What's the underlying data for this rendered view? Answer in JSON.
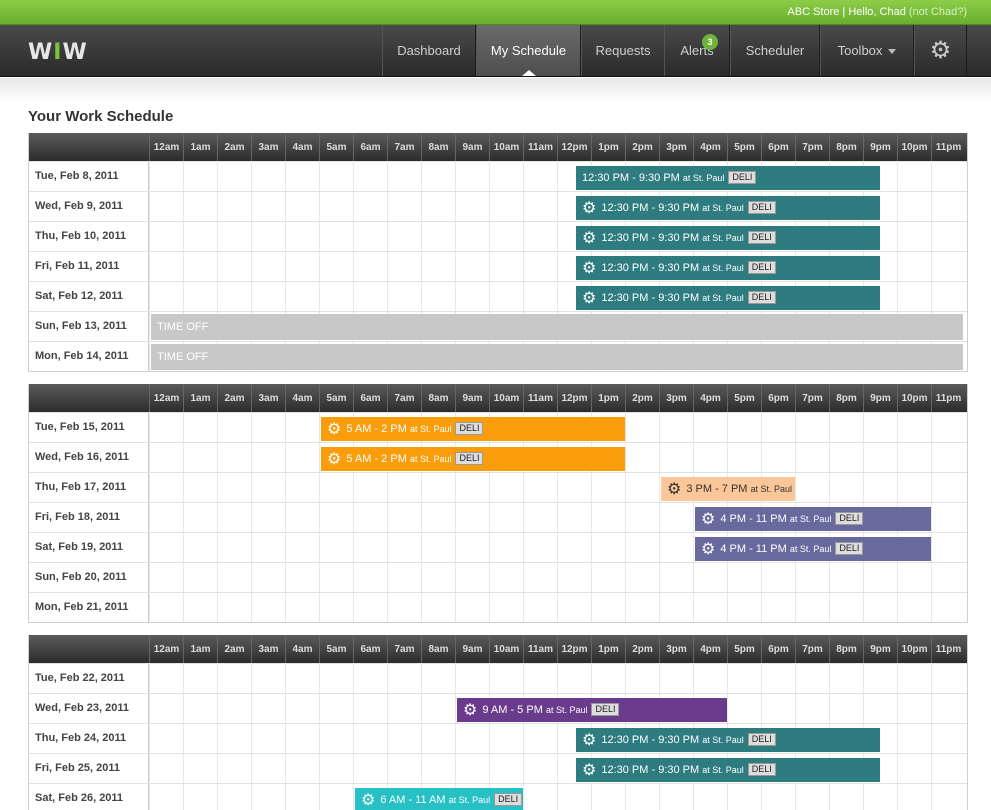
{
  "topbar": {
    "store": "ABC Store",
    "greeting": "Hello, Chad",
    "not_user": "(not Chad?)"
  },
  "logo": {
    "part1": "W",
    "part2": "I",
    "part3": "W"
  },
  "nav": [
    {
      "key": "dashboard",
      "label": "Dashboard",
      "active": false
    },
    {
      "key": "my-schedule",
      "label": "My Schedule",
      "active": true
    },
    {
      "key": "requests",
      "label": "Requests",
      "active": false
    },
    {
      "key": "alerts",
      "label": "Alerts",
      "active": false,
      "badge": "3"
    },
    {
      "key": "scheduler",
      "label": "Scheduler",
      "active": false
    },
    {
      "key": "toolbox",
      "label": "Toolbox",
      "active": false,
      "dropdown": true
    }
  ],
  "settings_icon": "gear-icon",
  "page_title": "Your Work Schedule",
  "hours": [
    "12am",
    "1am",
    "2am",
    "3am",
    "4am",
    "5am",
    "6am",
    "7am",
    "8am",
    "9am",
    "10am",
    "11am",
    "12pm",
    "1pm",
    "2pm",
    "3pm",
    "4pm",
    "5pm",
    "6pm",
    "7pm",
    "8pm",
    "9pm",
    "10pm",
    "11pm"
  ],
  "colors": {
    "teal": "#2e7b80",
    "orange": "#f99d0a",
    "peach": "#fbc799",
    "slate": "#686a9e",
    "purple": "#6a3a8d",
    "cyan": "#27c0c4",
    "timeoff": "#c8c8c8"
  },
  "weeks": [
    {
      "days": [
        {
          "label": "Tue, Feb 8, 2011",
          "shift": {
            "start": 12.5,
            "end": 21.5,
            "text": "12:30 PM - 9:30 PM",
            "at": "at St. Paul",
            "dept": "DELI",
            "color": "teal",
            "icon": false
          }
        },
        {
          "label": "Wed, Feb 9, 2011",
          "shift": {
            "start": 12.5,
            "end": 21.5,
            "text": "12:30 PM - 9:30 PM",
            "at": "at St. Paul",
            "dept": "DELI",
            "color": "teal",
            "icon": true
          }
        },
        {
          "label": "Thu, Feb 10, 2011",
          "shift": {
            "start": 12.5,
            "end": 21.5,
            "text": "12:30 PM - 9:30 PM",
            "at": "at St. Paul",
            "dept": "DELI",
            "color": "teal",
            "icon": true
          }
        },
        {
          "label": "Fri, Feb 11, 2011",
          "shift": {
            "start": 12.5,
            "end": 21.5,
            "text": "12:30 PM - 9:30 PM",
            "at": "at St. Paul",
            "dept": "DELI",
            "color": "teal",
            "icon": true
          }
        },
        {
          "label": "Sat, Feb 12, 2011",
          "shift": {
            "start": 12.5,
            "end": 21.5,
            "text": "12:30 PM - 9:30 PM",
            "at": "at St. Paul",
            "dept": "DELI",
            "color": "teal",
            "icon": true
          }
        },
        {
          "label": "Sun, Feb 13, 2011",
          "timeoff": "TIME OFF"
        },
        {
          "label": "Mon, Feb 14, 2011",
          "timeoff": "TIME OFF"
        }
      ]
    },
    {
      "days": [
        {
          "label": "Tue, Feb 15, 2011",
          "shift": {
            "start": 5,
            "end": 14,
            "text": "5 AM - 2 PM",
            "at": "at St. Paul",
            "dept": "DELI",
            "color": "orange",
            "icon": true
          }
        },
        {
          "label": "Wed, Feb 16, 2011",
          "shift": {
            "start": 5,
            "end": 14,
            "text": "5 AM - 2 PM",
            "at": "at St. Paul",
            "dept": "DELI",
            "color": "orange",
            "icon": true
          }
        },
        {
          "label": "Thu, Feb 17, 2011",
          "shift": {
            "start": 15,
            "end": 19,
            "text": "3 PM - 7 PM",
            "at": "at St. Paul",
            "dept": "",
            "color": "peach",
            "icon": true,
            "dark": true
          }
        },
        {
          "label": "Fri, Feb 18, 2011",
          "shift": {
            "start": 16,
            "end": 23,
            "text": "4 PM - 11 PM",
            "at": "at St. Paul",
            "dept": "DELI",
            "color": "slate",
            "icon": true
          }
        },
        {
          "label": "Sat, Feb 19, 2011",
          "shift": {
            "start": 16,
            "end": 23,
            "text": "4 PM - 11 PM",
            "at": "at St. Paul",
            "dept": "DELI",
            "color": "slate",
            "icon": true
          }
        },
        {
          "label": "Sun, Feb 20, 2011"
        },
        {
          "label": "Mon, Feb 21, 2011"
        }
      ]
    },
    {
      "days": [
        {
          "label": "Tue, Feb 22, 2011"
        },
        {
          "label": "Wed, Feb 23, 2011",
          "shift": {
            "start": 9,
            "end": 17,
            "text": "9 AM - 5 PM",
            "at": "at St. Paul",
            "dept": "DELI",
            "color": "purple",
            "icon": true
          }
        },
        {
          "label": "Thu, Feb 24, 2011",
          "shift": {
            "start": 12.5,
            "end": 21.5,
            "text": "12:30 PM - 9:30 PM",
            "at": "at St. Paul",
            "dept": "DELI",
            "color": "teal",
            "icon": true
          }
        },
        {
          "label": "Fri, Feb 25, 2011",
          "shift": {
            "start": 12.5,
            "end": 21.5,
            "text": "12:30 PM - 9:30 PM",
            "at": "at St. Paul",
            "dept": "DELI",
            "color": "teal",
            "icon": true
          }
        },
        {
          "label": "Sat, Feb 26, 2011",
          "shift": {
            "start": 6,
            "end": 11,
            "text": "6 AM - 11 AM",
            "at": "at St. Paul",
            "dept": "DELI",
            "color": "cyan",
            "icon": true
          }
        }
      ]
    }
  ]
}
